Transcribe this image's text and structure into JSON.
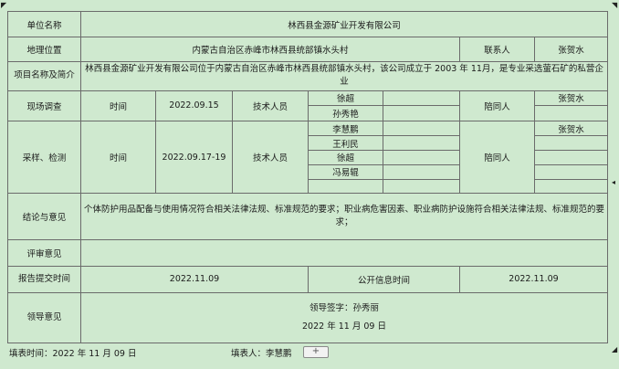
{
  "form": {
    "company_label": "单位名称",
    "company_name": "林西县金源矿业开发有限公司",
    "location_label": "地理位置",
    "location_value": "内蒙古自治区赤峰市林西县统部镇水头村",
    "contact_label": "联系人",
    "contact_value": "张贺水",
    "profile_label": "项目名称及简介",
    "profile_text": "林西县金源矿业开发有限公司位于内蒙古自治区赤峰市林西县统部镇水头村，该公司成立于 2003 年 11月，是专业采选萤石矿的私营企业",
    "survey_label": "现场调查",
    "time_label": "时间",
    "survey_date": "2022.09.15",
    "tech_label": "技术人员",
    "survey_staff": [
      "徐超",
      "孙秀艳"
    ],
    "accompany_label": "陪同人",
    "survey_accompany": "张贺水",
    "sampling_label": "采样、检测",
    "sampling_date": "2022.09.17-19",
    "sampling_staff": [
      "李慧鹏",
      "王利民",
      "徐超",
      "冯易辊"
    ],
    "sampling_accompany": "张贺水",
    "conclusion_label": "结论与意见",
    "conclusion_text": "个体防护用品配备与使用情况符合相关法律法规、标准规范的要求；职业病危害因素、职业病防护设施符合相关法律法规、标准规范的要求；",
    "review_label": "评审意见",
    "report_label": "报告提交时间",
    "report_date": "2022.11.09",
    "publish_label": "公开信息时间",
    "publish_date": "2022.11.09",
    "leader_label": "领导意见",
    "leader_sign": "领导签字：孙秀丽",
    "leader_date": "2022 年 11 月 09 日"
  },
  "footer": {
    "fill_time": "填表时间：2022 年 11 月 09 日",
    "filler": "填表人：李慧鹏",
    "plus_label": "+"
  },
  "icons": [
    "corner-arrow-icon",
    "plus-icon"
  ]
}
